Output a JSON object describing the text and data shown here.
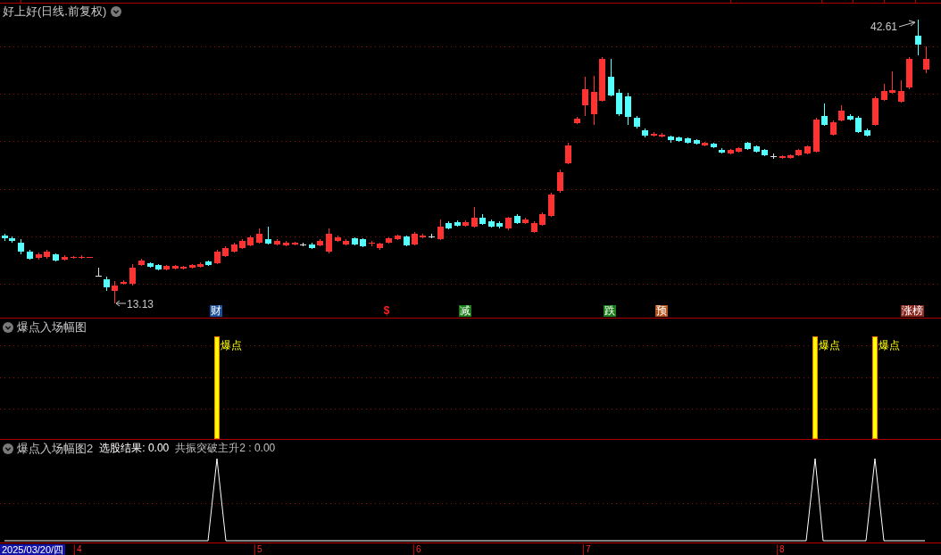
{
  "main_panel": {
    "title": "好上好(日线.前复权)",
    "high_label": "42.61",
    "low_label": "13.13",
    "signal_tags": [
      {
        "text": "财",
        "kind": "tag",
        "color": "#1c4f9e"
      },
      {
        "text": "$",
        "kind": "glyph",
        "color": "#ff2020"
      },
      {
        "text": "减",
        "kind": "tag",
        "color": "#1a7d1a"
      },
      {
        "text": "跌",
        "kind": "tag",
        "color": "#1a7d1a"
      },
      {
        "text": "预",
        "kind": "tag",
        "color": "#b4521c"
      },
      {
        "text": "涨榜",
        "kind": "tag",
        "color": "#8c2a22"
      }
    ]
  },
  "indicator_panel": {
    "title": "爆点入场幅图",
    "signals": [
      {
        "label": "爆点"
      },
      {
        "label": "爆点"
      },
      {
        "label": "爆点"
      }
    ]
  },
  "indicator_panel_2": {
    "title": "爆点入场幅图2",
    "readouts": [
      {
        "text": "选股结果: 0.00",
        "color": "#ffffff"
      },
      {
        "text": "共振突破主升2 : 0.00",
        "color": "#c0c0c0"
      }
    ]
  },
  "time_axis": {
    "cursor_date": "2025/03/20/四",
    "ticks": [
      "4",
      "5",
      "6",
      "7",
      "8"
    ]
  }
}
